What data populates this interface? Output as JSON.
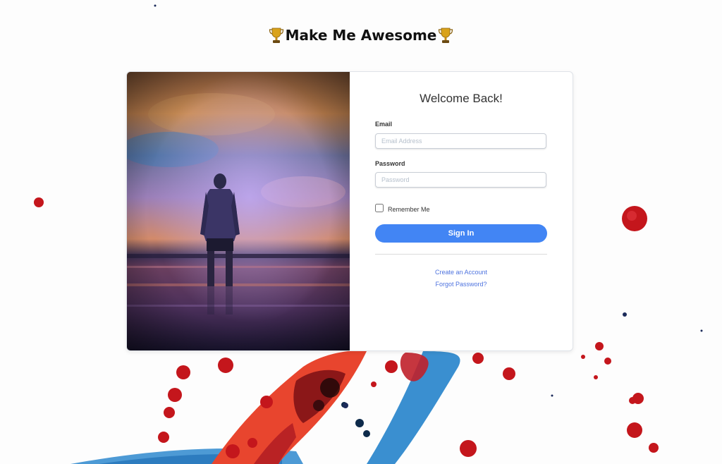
{
  "app": {
    "title": "Make Me Awesome",
    "accent_color": "#4285f4",
    "link_color": "#4e73df",
    "title_icons": [
      "trophy-icon",
      "trophy-icon"
    ]
  },
  "login": {
    "heading": "Welcome Back!",
    "email": {
      "label": "Email",
      "placeholder": "Email Address",
      "value": ""
    },
    "password": {
      "label": "Password",
      "placeholder": "Password",
      "value": ""
    },
    "remember": {
      "label": "Remember Me",
      "checked": false
    },
    "submit_label": "Sign In",
    "links": {
      "create_account": "Create an Account",
      "forgot_password": "Forgot Password?"
    }
  }
}
